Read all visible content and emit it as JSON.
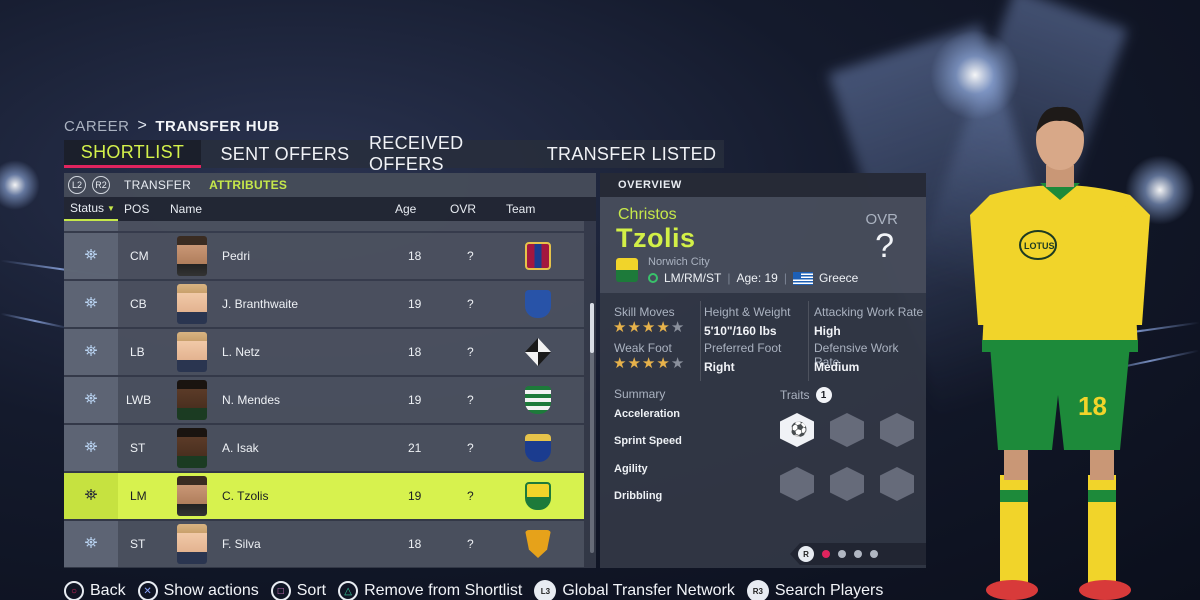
{
  "breadcrumb": {
    "root": "CAREER",
    "separator": ">",
    "current": "TRANSFER HUB"
  },
  "tabs": [
    {
      "label": "SHORTLIST",
      "active": true
    },
    {
      "label": "SENT OFFERS",
      "active": false
    },
    {
      "label": "RECEIVED OFFERS",
      "active": false
    },
    {
      "label": "TRANSFER LISTED",
      "active": false
    }
  ],
  "subtabs": {
    "l2": "L2",
    "r2": "R2",
    "transfer": "TRANSFER",
    "attributes": "ATTRIBUTES"
  },
  "columns": {
    "status": "Status",
    "pos": "POS",
    "name": "Name",
    "age": "Age",
    "ovr": "OVR",
    "team": "Team"
  },
  "players": [
    {
      "pos": "CM",
      "name": "Pedri",
      "age": "18",
      "ovr": "?",
      "team_icon": "barcelona-crest",
      "crest_color": "#a3173f",
      "crest_color2": "#1b3c8f",
      "skin": "mid",
      "selected": false
    },
    {
      "pos": "CB",
      "name": "J. Branthwaite",
      "age": "19",
      "ovr": "?",
      "team_icon": "everton-crest",
      "crest_color": "#2853a8",
      "crest_color2": "#2853a8",
      "skin": "fair",
      "selected": false
    },
    {
      "pos": "LB",
      "name": "L. Netz",
      "age": "18",
      "ovr": "?",
      "team_icon": "gladbach-crest",
      "crest_color": "#f2f2f2",
      "crest_color2": "#1a1a1a",
      "skin": "fair",
      "selected": false
    },
    {
      "pos": "LWB",
      "name": "N. Mendes",
      "age": "19",
      "ovr": "?",
      "team_icon": "sporting-crest",
      "crest_color": "#1d7a3a",
      "crest_color2": "#f2f2f2",
      "skin": "dark",
      "selected": false
    },
    {
      "pos": "ST",
      "name": "A. Isak",
      "age": "21",
      "ovr": "?",
      "team_icon": "real-sociedad-crest",
      "crest_color": "#1b3c8f",
      "crest_color2": "#e6c34a",
      "skin": "dark",
      "selected": false
    },
    {
      "pos": "LM",
      "name": "C. Tzolis",
      "age": "19",
      "ovr": "?",
      "team_icon": "norwich-crest",
      "crest_color": "#f1d42a",
      "crest_color2": "#1d7a3a",
      "skin": "mid",
      "selected": true
    },
    {
      "pos": "ST",
      "name": "F. Silva",
      "age": "18",
      "ovr": "?",
      "team_icon": "wolves-crest",
      "crest_color": "#e6a21a",
      "crest_color2": "#1a1a1a",
      "skin": "fair",
      "selected": false
    }
  ],
  "overview": {
    "header": "OVERVIEW",
    "first_name": "Christos",
    "last_name": "Tzolis",
    "ovr_label": "OVR",
    "ovr_value": "?",
    "club": "Norwich City",
    "positions": "LM/RM/ST",
    "age_text": "Age: 19",
    "nationality": "Greece",
    "skill_moves_label": "Skill Moves",
    "skill_moves": 4,
    "weak_foot_label": "Weak Foot",
    "weak_foot": 4,
    "height_weight_label": "Height & Weight",
    "height_weight": "5'10\"/160 lbs",
    "preferred_foot_label": "Preferred Foot",
    "preferred_foot": "Right",
    "attacking_wr_label": "Attacking Work Rate",
    "attacking_wr": "High",
    "defensive_wr_label": "Defensive Work Rate",
    "defensive_wr": "Medium",
    "summary_label": "Summary",
    "summary_items": [
      "Acceleration",
      "Sprint Speed",
      "Agility",
      "Dribbling"
    ],
    "traits_label": "Traits",
    "traits_count": "1",
    "pager_button": "R",
    "pager_pages": 4,
    "pager_active": 0
  },
  "footer": [
    {
      "button": "circle",
      "glyph": "○",
      "label": "Back"
    },
    {
      "button": "cross",
      "glyph": "✕",
      "label": "Show actions"
    },
    {
      "button": "square",
      "glyph": "□",
      "label": "Sort"
    },
    {
      "button": "triangle",
      "glyph": "△",
      "label": "Remove from Shortlist"
    },
    {
      "button": "stick",
      "glyph": "L3",
      "label": "Global Transfer Network"
    },
    {
      "button": "stick",
      "glyph": "R3",
      "label": "Search Players"
    }
  ],
  "player_render": {
    "shirt_number": "18",
    "sponsor": "LOTUS",
    "kit_primary": "#f1d42a",
    "kit_secondary": "#1d8a3a"
  }
}
